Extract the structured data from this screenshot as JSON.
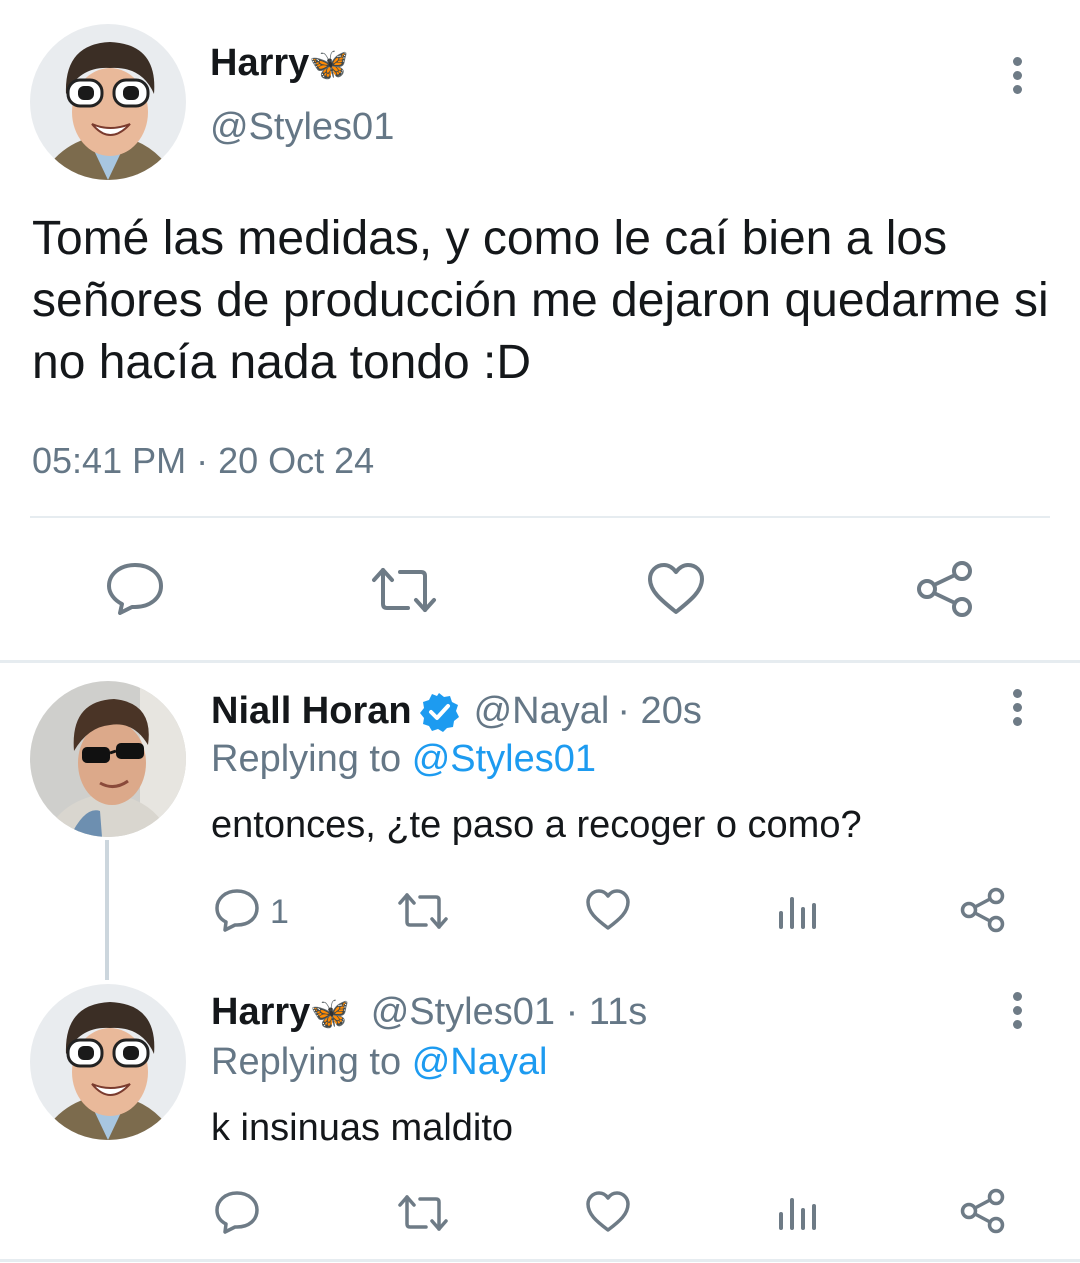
{
  "main_tweet": {
    "author_name": "Harry",
    "author_emoji": "🦋",
    "handle": "@Styles01",
    "text": "Tomé las medidas, y como le caí bien a los señores de producción me dejaron quedarme si no hacía nada tondo :D",
    "timestamp": "05:41 PM · 20 Oct 24",
    "actions": [
      "reply-icon",
      "retweet-icon",
      "like-icon",
      "share-icon"
    ]
  },
  "replies": [
    {
      "author_name": "Niall Horan",
      "verified": true,
      "handle": "@Nayal",
      "time": "· 20s",
      "replying_prefix": "Replying to",
      "replying_to": "@Styles01",
      "text": "entonces, ¿te paso a recoger o como?",
      "reply_count": "1",
      "actions": [
        "reply-icon",
        "retweet-icon",
        "like-icon",
        "analytics-icon",
        "share-icon"
      ]
    },
    {
      "author_name": "Harry",
      "author_emoji": "🦋",
      "handle": "@Styles01",
      "time": "· 11s",
      "replying_prefix": "Replying to",
      "replying_to": "@Nayal",
      "text": "k insinuas maldito",
      "reply_count": "",
      "actions": [
        "reply-icon",
        "retweet-icon",
        "like-icon",
        "analytics-icon",
        "share-icon"
      ]
    }
  ],
  "colors": {
    "link": "#1d9bf0",
    "muted": "#657786",
    "icon": "#6e7b86",
    "verified": "#1d9bf0",
    "butterfly": "#e8831f"
  }
}
